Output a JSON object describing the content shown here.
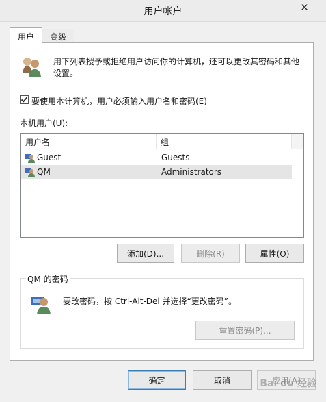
{
  "window": {
    "title": "用户帐户",
    "close_symbol": "✕"
  },
  "tabs": [
    {
      "label": "用户"
    },
    {
      "label": "高级"
    }
  ],
  "intro_text_line1": "用下列表授予或拒绝用户访问你的计算机，还可以更改其密码和其他",
  "intro_text_line2": "设置。",
  "checkbox": {
    "label": "要使用本计算机，用户必须输入用户名和密码(E)",
    "checked": true
  },
  "local_users_label": "本机用户(U):",
  "listview": {
    "columns": [
      "用户名",
      "组"
    ],
    "rows": [
      {
        "username": "Guest",
        "group": "Guests",
        "selected": false
      },
      {
        "username": "QM",
        "group": "Administrators",
        "selected": true
      }
    ]
  },
  "buttons": {
    "add": "添加(D)...",
    "remove": "删除(R)",
    "properties": "属性(O)",
    "reset_password": "重置密码(P)...",
    "ok": "确定",
    "cancel": "取消",
    "apply": "应用(A)"
  },
  "password_group": {
    "title": "QM 的密码",
    "text": "要改密码，按 Ctrl-Alt-Del 并选择“更改密码”。"
  },
  "watermark": "Bai du 经验",
  "icons": [
    "users-icon",
    "user-icon",
    "user-password-icon",
    "checkmark-icon",
    "close-icon"
  ],
  "colors": {
    "panel": "#ffffff",
    "dialog": "#f0f0f0",
    "selected_row": "#e5e5e5",
    "default_button_border": "#3c7fb1"
  }
}
